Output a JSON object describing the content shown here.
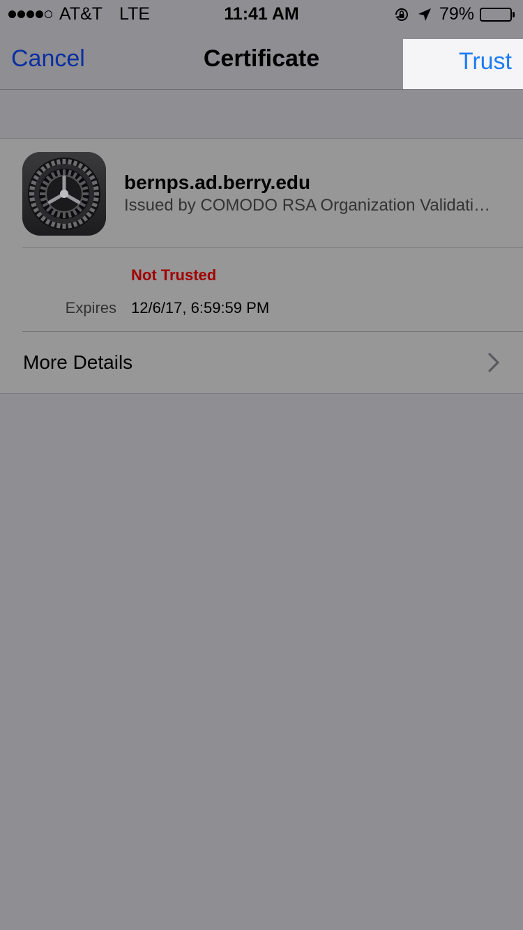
{
  "status_bar": {
    "signal_filled": 4,
    "signal_total": 5,
    "carrier": "AT&T",
    "network": "LTE",
    "time": "11:41 AM",
    "battery_percent_label": "79%",
    "battery_level": 0.79,
    "icons": [
      "rotation-lock-icon",
      "location-arrow-icon",
      "battery-icon"
    ]
  },
  "nav_bar": {
    "cancel_label": "Cancel",
    "title": "Certificate",
    "trust_label": "Trust",
    "link_color": "#0b2fa0",
    "trust_color": "#1c7cf4"
  },
  "certificate": {
    "icon": "settings-gear-icon",
    "name": "bernps.ad.berry.edu",
    "issuer": "Issued by COMODO RSA Organization Validati…",
    "status": "Not Trusted",
    "status_color": "#a10000",
    "expires_label": "Expires",
    "expires_value": "12/6/17, 6:59:59 PM"
  },
  "more_details": {
    "label": "More Details",
    "icon": "chevron-right-icon"
  }
}
